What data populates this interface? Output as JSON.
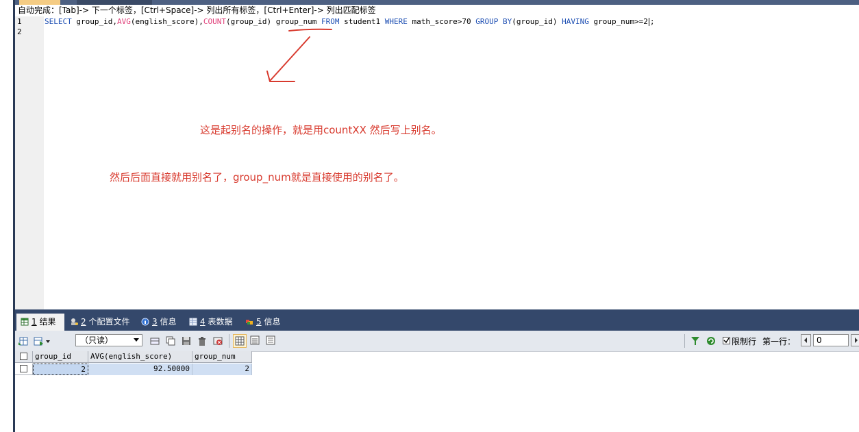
{
  "editor": {
    "hint": "自动完成：[Tab]-> 下一个标签，[Ctrl+Space]-> 列出所有标签，[Ctrl+Enter]-> 列出匹配标签",
    "line_numbers": [
      "1",
      "2"
    ],
    "sql": {
      "kw_select": "SELECT",
      "t1": " group_id,",
      "fn_avg": "AVG",
      "t2": "(english_score),",
      "fn_count": "COUNT",
      "t3": "(group_id) group_num ",
      "kw_from": "FROM",
      "t4": " student1 ",
      "kw_where": "WHERE",
      "t5": " math_score>70 ",
      "kw_group": "GROUP BY",
      "t6": "(group_id) ",
      "kw_having": "HAVING",
      "t7": " group_num>=2",
      "t8": ";"
    }
  },
  "annotations": {
    "note1": "这是起别名的操作，就是用countXX  然后写上别名。",
    "note2": "然后后面直接就用别名了，group_num就是直接使用的别名了。",
    "color": "#d83a2e"
  },
  "results_tabs": [
    {
      "num": "1",
      "label": " 结果",
      "icon": "result-grid-icon"
    },
    {
      "num": "2",
      "label": " 个配置文件",
      "icon": "profile-icon"
    },
    {
      "num": "3",
      "label": " 信息",
      "icon": "info-icon"
    },
    {
      "num": "4",
      "label": " 表数据",
      "icon": "table-data-icon"
    },
    {
      "num": "5",
      "label": " 信息",
      "icon": "info-icon"
    }
  ],
  "toolbar": {
    "mode_select": "（只读）",
    "limit_rows_label": "限制行",
    "first_row_label": "第一行：",
    "first_row_value": "0",
    "limit_rows_checked": true
  },
  "result_grid": {
    "columns": [
      "group_id",
      "AVG(english_score)",
      "group_num"
    ],
    "rows": [
      [
        "2",
        "92.50000",
        "2"
      ]
    ]
  },
  "colors": {
    "keyword": "#1e4fb3",
    "function": "#e0407a",
    "tab_bar": "#34486b",
    "cell_fill": "#d0dff3"
  }
}
